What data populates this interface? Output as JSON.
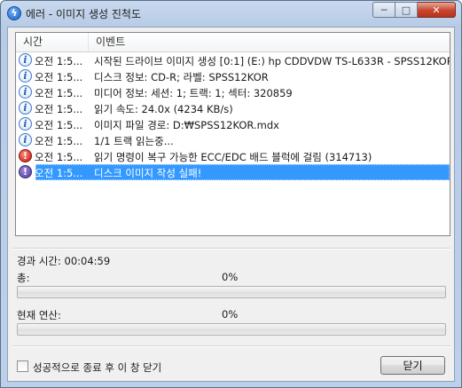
{
  "window": {
    "title": "에러 - 이미지 생성 진척도"
  },
  "caption_buttons": {
    "minimize": "─",
    "maximize": "□",
    "close": "✕"
  },
  "list": {
    "columns": {
      "time": "시간",
      "event": "이벤트"
    },
    "rows": [
      {
        "icon": "info-icon",
        "time": "오전 1:5...",
        "event": "시작된 드라이브 이미지 생성 [0:1] (E:) hp CDDVDW TS-L633R - SPSS12KOR"
      },
      {
        "icon": "info-icon",
        "time": "오전 1:5...",
        "event": "디스크 정보: CD-R; 라벨: SPSS12KOR"
      },
      {
        "icon": "info-icon",
        "time": "오전 1:5...",
        "event": "미디어 정보: 세션: 1; 트랙: 1; 섹터: 320859"
      },
      {
        "icon": "info-icon",
        "time": "오전 1:5...",
        "event": "읽기 속도: 24.0x (4234 KB/s)"
      },
      {
        "icon": "info-icon",
        "time": "오전 1:5...",
        "event": "이미지 파일 경로: D:₩SPSS12KOR.mdx"
      },
      {
        "icon": "info-icon",
        "time": "오전 1:5...",
        "event": "1/1 트랙 읽는중..."
      },
      {
        "icon": "error-icon",
        "time": "오전 1:5...",
        "event": "읽기 명령이 복구 가능한 ECC/EDC 배드 블럭에 걸림 (314713)"
      },
      {
        "icon": "warning-icon",
        "time": "오전 1:5...",
        "event": "디스크 이미지 작성 실패!",
        "selected": true
      }
    ]
  },
  "status": {
    "elapsed": "경과 시간: 00:04:59",
    "total_label": "총:",
    "total_percent": "0%",
    "total_progress": 0,
    "current_label": "현재 연산:",
    "current_percent": "0%",
    "current_progress": 0
  },
  "footer": {
    "checkbox_label": "성공적으로 종료 후 이 창 닫기",
    "checkbox_checked": false,
    "close_button": "닫기"
  },
  "colors": {
    "selection": "#3399ff",
    "title_bar": "#c9d9ee",
    "close_caption": "#c7452c"
  }
}
